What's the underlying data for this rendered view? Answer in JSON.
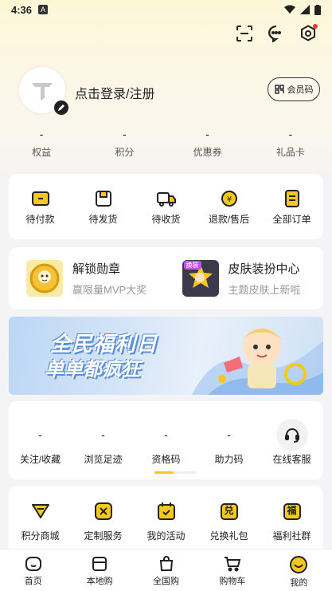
{
  "status_bar": {
    "time": "4:36"
  },
  "profile": {
    "login_text": "点击登录/注册",
    "member_button": "会员码"
  },
  "stats": [
    {
      "value": "-",
      "label": "权益"
    },
    {
      "value": "-",
      "label": "积分"
    },
    {
      "value": "-",
      "label": "优惠券"
    },
    {
      "value": "-",
      "label": "礼品卡"
    }
  ],
  "orders": [
    {
      "label": "待付款",
      "icon": "wallet-icon"
    },
    {
      "label": "待发货",
      "icon": "package-icon"
    },
    {
      "label": "待收货",
      "icon": "truck-icon"
    },
    {
      "label": "退款/售后",
      "icon": "refund-icon"
    },
    {
      "label": "全部订单",
      "icon": "list-icon"
    }
  ],
  "promos": [
    {
      "title": "解锁勋章",
      "subtitle": "赢限量MVP大奖"
    },
    {
      "title": "皮肤装扮中心",
      "subtitle": "主题皮肤上新啦",
      "badge": "换装"
    }
  ],
  "banner": {
    "title_line1": "全民福利日",
    "title_line2": "单单都疯狂"
  },
  "tools": [
    {
      "value": "-",
      "label": "关注/收藏"
    },
    {
      "value": "-",
      "label": "浏览足迹"
    },
    {
      "value": "-",
      "label": "资格码"
    },
    {
      "value": "-",
      "label": "助力码"
    },
    {
      "value": "",
      "label": "在线客服"
    }
  ],
  "services": [
    {
      "label": "积分商城",
      "icon": "points-mall-icon"
    },
    {
      "label": "定制服务",
      "icon": "custom-service-icon"
    },
    {
      "label": "我的活动",
      "icon": "activity-icon"
    },
    {
      "label": "兑换礼包",
      "icon": "redeem-icon",
      "glyph": "兑"
    },
    {
      "label": "福利社群",
      "icon": "welfare-icon",
      "glyph": "福"
    }
  ],
  "tabbar": [
    {
      "label": "首页",
      "icon": "home-icon"
    },
    {
      "label": "本地购",
      "icon": "local-shop-icon"
    },
    {
      "label": "全国购",
      "icon": "national-shop-icon"
    },
    {
      "label": "购物车",
      "icon": "cart-icon"
    },
    {
      "label": "我的",
      "icon": "profile-icon",
      "active": true
    }
  ],
  "colors": {
    "accent": "#f5c81d",
    "text": "#222222",
    "muted": "#999999"
  }
}
